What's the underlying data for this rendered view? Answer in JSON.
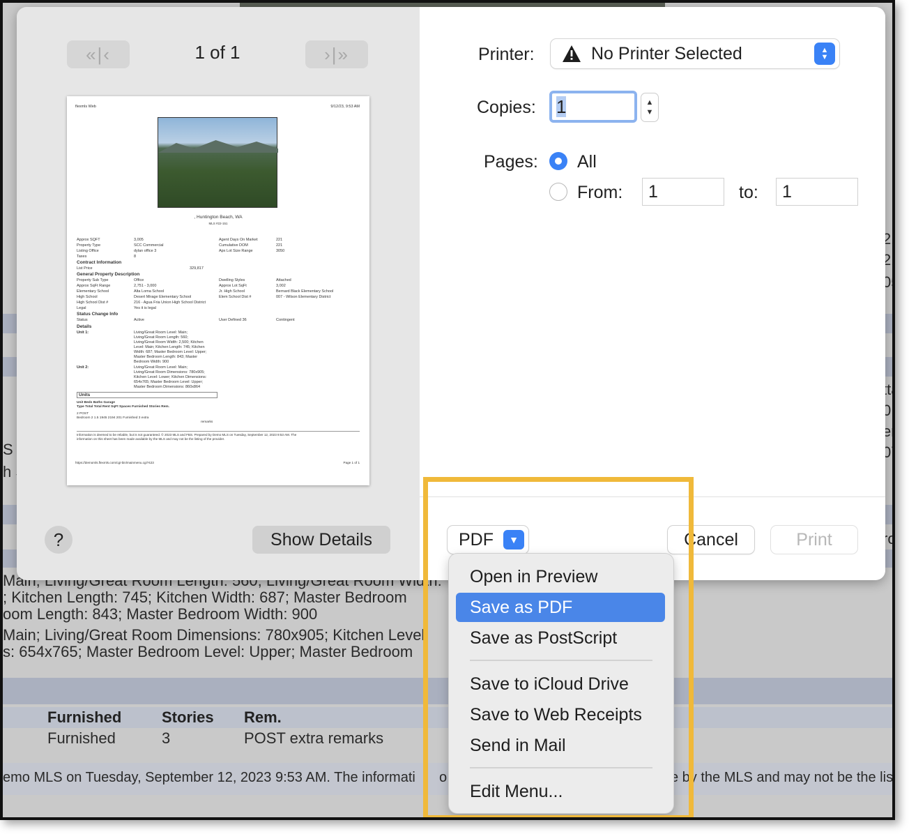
{
  "background_page": {
    "lines": [
      "Main; Living/Great Room Length: 560; Living/Great Room Width:",
      "; Kitchen Length: 745; Kitchen Width: 687; Master Bedroom",
      "oom Length: 843; Master Bedroom Width: 900",
      "Main; Living/Great Room Dimensions: 780x905; Kitchen Level",
      "s: 654x765; Master Bedroom Level: Upper; Master Bedroom"
    ],
    "table_headers": [
      "Furnished",
      "Stories",
      "Rem."
    ],
    "table_row": [
      "Furnished",
      "3",
      "POST extra remarks"
    ],
    "footer_left": "emo MLS on Tuesday, September 12, 2023 9:53 AM. The informati",
    "footer_mid": "o",
    "footer_right": "e by the MLS and may not be the list",
    "right_edge": [
      "21",
      "21",
      "05",
      "tta",
      "0",
      "er",
      "07",
      "ro"
    ],
    "left_edge": [
      "S",
      "h S"
    ]
  },
  "preview": {
    "first_label": "«|‹",
    "next_label": "›|»",
    "page_counter": "1 of 1",
    "page": {
      "header_left": "flexmls Web",
      "header_right": "9/12/23, 9:53 AM",
      "address": ", Huntington Beach, WA",
      "mls": "MLS #22-151",
      "rows_left": [
        [
          "Approx SQFT",
          "3,005"
        ],
        [
          "Property Type",
          "SCC Commercial"
        ],
        [
          "Listing Office",
          "dylan office 3"
        ],
        [
          "Taxes",
          "8"
        ]
      ],
      "rows_right": [
        [
          "Agent Days On Market",
          "221"
        ],
        [
          "Cumulative DOM",
          "221"
        ],
        [
          "Apx Lot Size Range",
          "3050"
        ]
      ],
      "contract_heading": "Contract Information",
      "list_price_label": "List Price",
      "list_price": "329,817",
      "general_heading": "General Property Description",
      "general_left": [
        [
          "Property Sub Type",
          "Office"
        ],
        [
          "Approx SqFt Range",
          "2,751 - 3,000"
        ],
        [
          "Elementary School",
          "Alta Loma School"
        ],
        [
          "High School",
          "Desert Mirage Elementary School"
        ],
        [
          "High School Dist #",
          "216 - Agua Fria Union High School District"
        ],
        [
          "Legal",
          "Yes it is legal"
        ]
      ],
      "general_right": [
        [
          "Dwelling Styles",
          "Attached"
        ],
        [
          "Approx Lot SqFt",
          "3,002"
        ],
        [
          "Jr. High School",
          "Bernard Black Elementary School"
        ],
        [
          "Elem School Dist #",
          "007 - Wilson Elementary District"
        ]
      ],
      "status_heading": "Status Change Info",
      "status_label": "Status",
      "status_value": "Active",
      "user_defined_label": "User Defined 36",
      "user_defined_value": "Contingent",
      "details_heading": "Details",
      "unit1_label": "Unit 1:",
      "unit1_lines": [
        "Living/Great Room Level: Main;",
        "Living/Great Room Length: 560;",
        "Living/Great Room Width: 2,500; Kitchen",
        "Level: Main; Kitchen Length: 745; Kitchen",
        "Width: 687; Master Bedroom Level: Upper;",
        "Master Bedroom Length: 843; Master",
        "Bedroom Width: 900"
      ],
      "unit2_label": "Unit 2:",
      "unit2_lines": [
        "Living/Great Room Level: Main;",
        "Living/Great Room Dimensions: 780x905;",
        "Kitchen Level: Lower; Kitchen Dimensions:",
        "654x765; Master Bedroom Level: Upper;",
        "Master Bedroom Dimensions: 860x864"
      ],
      "units_heading": "Units",
      "units_header_1": "Unit    Beds  Baths              Garage",
      "units_header_2": "Type   Total  Total   Rent SqFt Spaces  Furnished Stories Rem.",
      "units_row_1": "2                                                     POST",
      "units_row_2": "Bedroom  2      1.5     1945 2194 201      Furnished   3       extra",
      "units_row_3": "remarks",
      "disclaimer_1": "Information is deemed to be reliable, but is not guaranteed. © 2023 MLS and FBS. Prepared by Demo MLS on Tuesday, September 12, 2023 9:53 AM. The",
      "disclaimer_2": "information on this sheet has been made available by the MLS and may not be the listing of the provider.",
      "footer_left": "https://demomls.flexmls.com/cgi-bin/mainmenu.cgi?423",
      "footer_right": "Page 1 of 1"
    },
    "help_label": "?",
    "show_details_label": "Show Details"
  },
  "settings": {
    "printer_label": "Printer:",
    "printer_value": "No Printer Selected",
    "copies_label": "Copies:",
    "copies_value": "1",
    "pages_label": "Pages:",
    "all_label": "All",
    "from_label": "From:",
    "from_value": "1",
    "to_label": "to:",
    "to_value": "1"
  },
  "footer": {
    "pdf_label": "PDF",
    "cancel_label": "Cancel",
    "print_label": "Print"
  },
  "pdf_menu": {
    "items": [
      "Open in Preview",
      "Save as PDF",
      "Save as PostScript",
      "Save to iCloud Drive",
      "Save to Web Receipts",
      "Send in Mail",
      "Edit Menu..."
    ],
    "selected": "Save as PDF"
  },
  "colors": {
    "accent": "#3a82f6",
    "highlight_box": "#f0b93a",
    "menu_selection": "#4a86e8",
    "background_band": "#aab0bf"
  }
}
